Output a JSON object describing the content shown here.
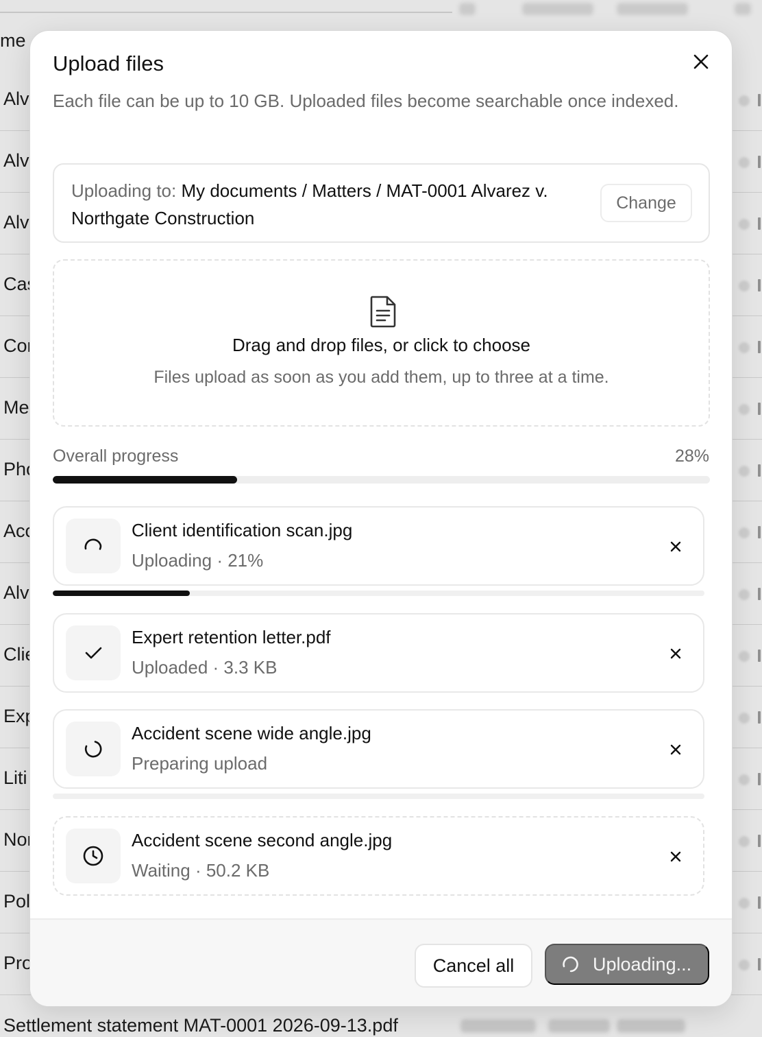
{
  "background": {
    "header_text": "me",
    "rows": [
      "Alv",
      "Alv",
      "Alv",
      "Cas",
      "Cor",
      "Me",
      "Pho",
      "Acc",
      "Alv",
      "Clie",
      "Exp",
      "Liti",
      "Nor",
      "Pol",
      "Pro"
    ],
    "bottom_row": "Settlement statement MAT-0001 2026-09-13.pdf"
  },
  "modal": {
    "title": "Upload files",
    "subtitle": "Each file can be up to 10 GB. Uploaded files become searchable once indexed.",
    "destination": {
      "prefix": "Uploading to:",
      "path": "My documents / Matters / MAT-0001 Alvarez v. Northgate Construction",
      "change_label": "Change"
    },
    "dropzone": {
      "icon": "document-icon",
      "title": "Drag and drop files, or click to choose",
      "subtitle": "Files upload as soon as you add them, up to three at a time."
    },
    "overall": {
      "label": "Overall progress",
      "percent_label": "28%",
      "progress": 0.28
    },
    "files": [
      {
        "name": "Client identification scan.jpg",
        "status": "Uploading · 21%",
        "icon": "spinner-icon",
        "progress": 0.21
      },
      {
        "name": "Expert retention letter.pdf",
        "status": "Uploaded · 3.3 KB",
        "icon": "check-icon"
      },
      {
        "name": "Accident scene wide angle.jpg",
        "status": "Preparing upload",
        "icon": "spinner-icon",
        "progress": 0
      },
      {
        "name": "Accident scene second angle.jpg",
        "status": "Waiting · 50.2 KB",
        "icon": "clock-icon"
      }
    ],
    "footer": {
      "cancel_label": "Cancel all",
      "upload_label": "Uploading..."
    }
  },
  "colors": {
    "accent": "#111111",
    "muted_text": "#6b6b6b",
    "disabled_button": "#7d7d7d"
  }
}
